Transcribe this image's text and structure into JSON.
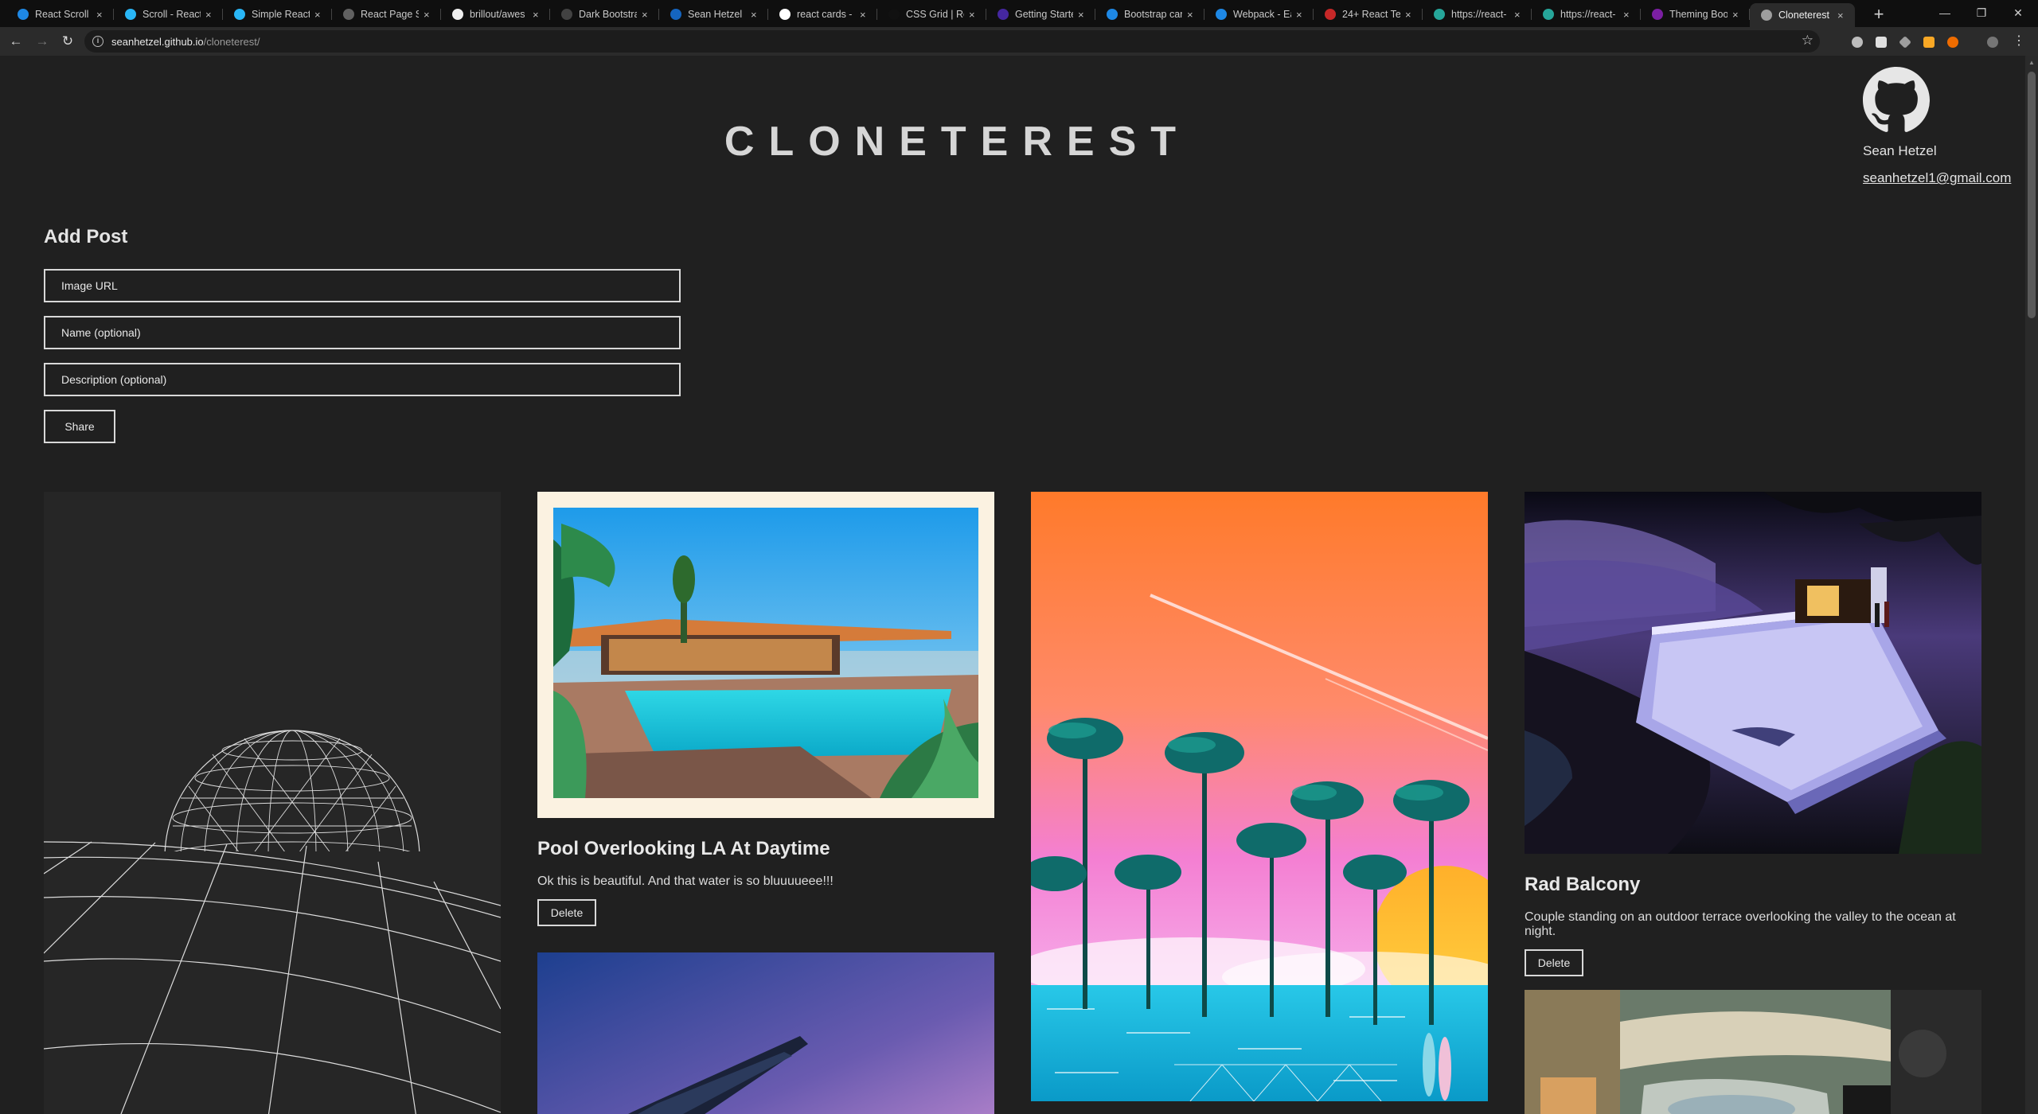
{
  "browser": {
    "tabs": [
      {
        "label": "React Scroll",
        "color": "#1e88e5"
      },
      {
        "label": "Scroll - React",
        "color": "#29b6f6"
      },
      {
        "label": "Simple React",
        "color": "#29b6f6"
      },
      {
        "label": "React Page Sc",
        "color": "#616161"
      },
      {
        "label": "brillout/awes",
        "color": "#eeeeee"
      },
      {
        "label": "Dark Bootstra",
        "color": "#424242"
      },
      {
        "label": "Sean Hetzel",
        "color": "#1565c0"
      },
      {
        "label": "react cards -",
        "color": "#ffffff"
      },
      {
        "label": "CSS Grid | Rei",
        "color": "#111111"
      },
      {
        "label": "Getting Starte",
        "color": "#4527a0"
      },
      {
        "label": "Bootstrap car",
        "color": "#1e88e5"
      },
      {
        "label": "Webpack - Ea",
        "color": "#1e88e5"
      },
      {
        "label": "24+ React Te",
        "color": "#c62828"
      },
      {
        "label": "https://react-",
        "color": "#26a69a"
      },
      {
        "label": "https://react-",
        "color": "#26a69a"
      },
      {
        "label": "Theming Boo",
        "color": "#7b1fa2"
      },
      {
        "label": "Cloneterest",
        "color": "#9e9e9e"
      }
    ],
    "url_host": "seanhetzel.github.io",
    "url_path": "/cloneterest/"
  },
  "site": {
    "title": "CLONETEREST"
  },
  "profile": {
    "name": "Sean Hetzel",
    "email": "seanhetzel1@gmail.com"
  },
  "add_post": {
    "heading": "Add Post",
    "image_url_placeholder": "Image URL",
    "name_placeholder": "Name (optional)",
    "description_placeholder": "Description (optional)",
    "share_label": "Share"
  },
  "posts": [
    {
      "title": "",
      "description": ""
    },
    {
      "title": "Pool Overlooking LA At Daytime",
      "description": "Ok this is beautiful. And that water is so bluuuueee!!!",
      "delete_label": "Delete"
    },
    {
      "title": "",
      "description": ""
    },
    {
      "title": "Rad Balcony",
      "description": "Couple standing on an outdoor terrace overlooking the valley to the ocean at night.",
      "delete_label": "Delete"
    },
    {
      "title": "",
      "description": ""
    },
    {
      "title": "",
      "description": ""
    }
  ]
}
